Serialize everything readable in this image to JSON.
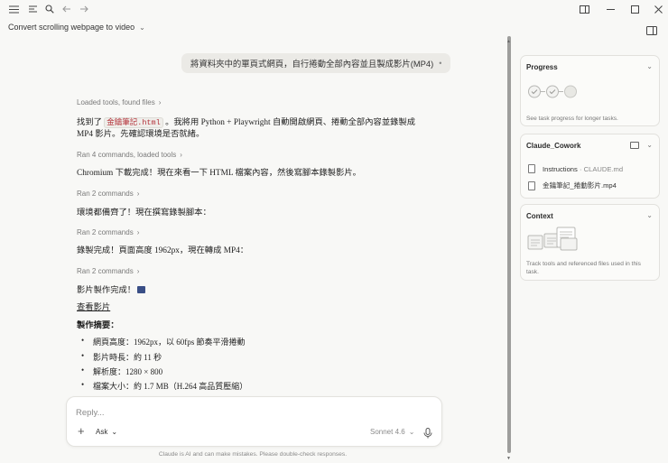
{
  "titlebar": {
    "icons": [
      "sidebar-toggle-icon",
      "menu-icon",
      "search-icon",
      "back-arrow-icon",
      "forward-arrow-icon"
    ],
    "window_controls": [
      "layout-icon",
      "minimize-icon",
      "maximize-icon",
      "close-icon"
    ]
  },
  "header": {
    "title": "Convert scrolling webpage to video"
  },
  "chat": {
    "user_message": "將資料夾中的單頁式網頁，自行捲動全部內容並且製成影片(MP4)",
    "steps": [
      {
        "label": "Loaded tools, found files"
      },
      {
        "label": "Ran 4 commands, loaded tools"
      },
      {
        "label": "Ran 2 commands"
      },
      {
        "label": "Ran 2 commands"
      },
      {
        "label": "Ran 2 commands"
      }
    ],
    "msg1_pre": "找到了",
    "msg1_code": "金鑰筆記.html",
    "msg1_post": "。我將用 Python + Playwright 自動開啟網頁、捲動全部內容並錄製成",
    "msg1_line2": "MP4 影片。先確認環境是否就緒。",
    "msg2": "Chromium 下載完成！現在來看一下 HTML 檔案內容，然後寫腳本錄製影片。",
    "msg3": "環境都備齊了！現在撰寫錄製腳本：",
    "msg4": "錄製完成！頁面高度 1962px，現在轉成 MP4：",
    "msg5": "影片製作完成！",
    "view_link": "查看影片",
    "summary_heading": "製作摘要：",
    "summary_items": [
      "網頁高度：1962px，以 60fps 節奏平滑捲動",
      "影片時長：約 11 秒",
      "解析度：1280 × 800",
      "檔案大小：約 1.7 MB（H.264 高品質壓縮）"
    ]
  },
  "composer": {
    "placeholder": "Reply...",
    "mode": "Ask",
    "model": "Sonnet 4.6"
  },
  "disclaimer": "Claude is AI and can make mistakes. Please double-check responses.",
  "panels": {
    "progress": {
      "title": "Progress",
      "note": "See task progress for longer tasks."
    },
    "folder": {
      "title": "Claude_Cowork",
      "files": [
        {
          "name": "Instructions",
          "sub": "· CLAUDE.md"
        },
        {
          "name": "金鑰筆記_捲動影片.mp4",
          "sub": ""
        }
      ]
    },
    "context": {
      "title": "Context",
      "note_line1": "Track tools and referenced files used in this",
      "note_line2": "task."
    }
  },
  "colors": {
    "background": "#f8f8f6",
    "code_text": "#b4323a",
    "user_bubble": "#ebeae6"
  }
}
